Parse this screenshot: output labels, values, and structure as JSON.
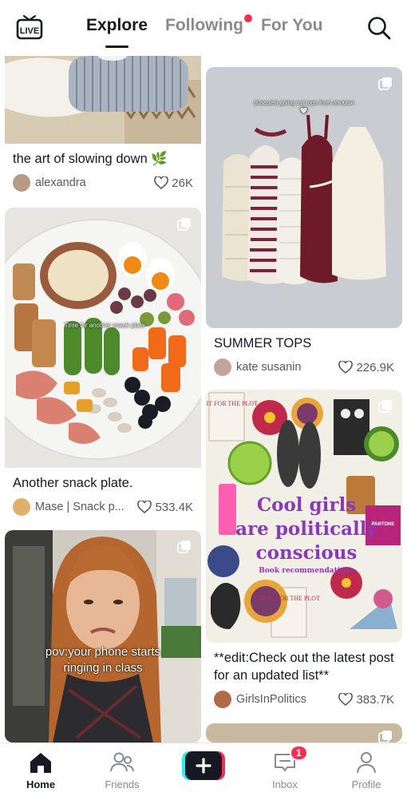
{
  "header": {
    "live_label": "LIVE",
    "tabs": [
      {
        "label": "Explore",
        "active": true
      },
      {
        "label": "Following",
        "active": false,
        "has_dot": true
      },
      {
        "label": "For You",
        "active": false
      }
    ],
    "search_icon": "search-icon"
  },
  "feed": {
    "left": [
      {
        "caption": "the art of slowing down 🌿",
        "user": "alexandra",
        "likes": "26K"
      },
      {
        "caption": "Another snack plate.",
        "user": "Mase | Snack p...",
        "likes": "533.4K",
        "overlay": "Time for another snack plate",
        "multi": true
      },
      {
        "caption": "",
        "user": "",
        "likes": "",
        "overlay": "pov:your phone starts ringing in class",
        "multi": true
      }
    ],
    "right": [
      {
        "caption": "SUMMER TOPS",
        "user": "kate susanin",
        "likes": "226.9K",
        "overlay": "(classier) going out tops from amazon 🤍",
        "multi": true
      },
      {
        "caption": "**edit:Check out the latest post for an updated list**",
        "user": "GirlsInPolitics",
        "likes": "383.7K",
        "collage_title_1": "Cool girls",
        "collage_title_2": "are politically",
        "collage_title_3": "conscious",
        "collage_sub": "Book recommendations",
        "book_text": "DO IT FOR THE PLOT",
        "pantone": "PANTONE",
        "multi": true
      },
      {
        "caption": "",
        "user": "",
        "likes": "",
        "multi": true
      }
    ]
  },
  "bottom_nav": {
    "items": [
      {
        "label": "Home",
        "icon": "home-icon",
        "active": true
      },
      {
        "label": "Friends",
        "icon": "friends-icon",
        "active": false
      },
      {
        "label": "",
        "icon": "plus-icon",
        "active": false
      },
      {
        "label": "Inbox",
        "icon": "inbox-icon",
        "active": false,
        "badge": "1"
      },
      {
        "label": "Profile",
        "icon": "profile-icon",
        "active": false
      }
    ]
  },
  "colors": {
    "accent": "#fe2c55",
    "plus_cyan": "#25f4ee",
    "text_primary": "#161823",
    "text_secondary": "#8a8b91"
  }
}
